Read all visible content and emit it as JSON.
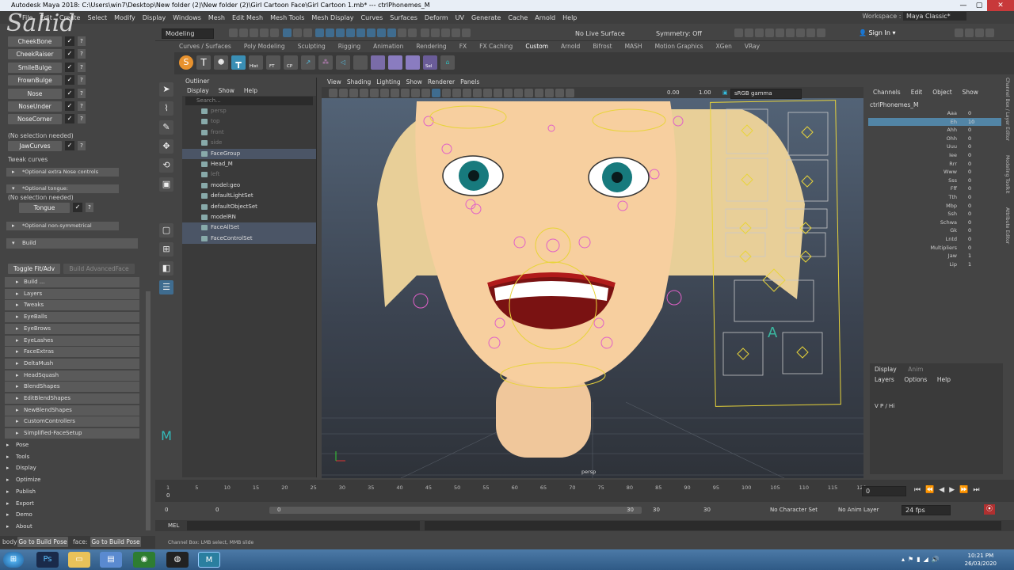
{
  "window": {
    "title": "Autodesk Maya 2018: C:\\Users\\win7\\Desktop\\New folder (2)\\New folder (2)\\Girl Cartoon Face\\Girl Cartoon 1.mb*   ---   ctrlPhonemes_M"
  },
  "menubar": [
    "File",
    "Edit",
    "Create",
    "Select",
    "Modify",
    "Display",
    "Windows",
    "Mesh",
    "Edit Mesh",
    "Mesh Tools",
    "Mesh Display",
    "Curves",
    "Surfaces",
    "Deform",
    "UV",
    "Generate",
    "Cache",
    "Arnold",
    "Help"
  ],
  "workspace": {
    "label": "Workspace :",
    "value": "Maya Classic*"
  },
  "statusline": {
    "mode": "Modeling",
    "live_surface": "No Live Surface",
    "symmetry": "Symmetry: Off",
    "signin": "Sign In"
  },
  "shelf_tabs": [
    "Curves / Surfaces",
    "Poly Modeling",
    "Sculpting",
    "Rigging",
    "Animation",
    "Rendering",
    "FX",
    "FX Caching",
    "Custom",
    "Arnold",
    "Bifrost",
    "MASH",
    "Motion Graphics",
    "XGen",
    "VRay"
  ],
  "shelf_labels": [
    "Hist",
    "FT",
    "CP",
    "Sel"
  ],
  "watermark": "Sahid",
  "rig_panel": {
    "controls": [
      "CheekBone",
      "CheekRaiser",
      "SmileBulge",
      "FrownBulge",
      "Nose",
      "NoseUnder",
      "NoseCorner"
    ],
    "no_sel_1": "(No selection needed)",
    "jaw_curves": "JawCurves",
    "tweak_curves": "Tweak curves",
    "opt_nose": "*Optional extra Nose controls",
    "opt_tongue": "*Optional tongue:",
    "no_sel_2": "(No selection needed)",
    "tongue": "Tongue",
    "opt_nonsym": "*Optional non-symmetrical",
    "build": "Build",
    "toggle_fit": "Toggle Fit/Adv",
    "build_adv": "Build AdvancedFace",
    "sub_items": [
      "Build ...",
      "Layers",
      "Tweaks",
      "EyeBalls",
      "EyeBrows",
      "EyeLashes",
      "FaceExtras",
      "DeltaMush",
      "HeadSquash",
      "BlendShapes",
      "EditBlendShapes",
      "NewBlendShapes",
      "CustomControllers",
      "Simplified-FaceSetup"
    ],
    "top_items": [
      "Pose",
      "Tools",
      "Display",
      "Optimize",
      "Publish",
      "Export",
      "Demo",
      "About"
    ],
    "check": "✓",
    "help": "?"
  },
  "bottom_left": {
    "body_label": "body",
    "body_btn": "Go to Build Pose",
    "face_label": "face:",
    "face_btn": "Go to Build Pose"
  },
  "outliner": {
    "title": "Outliner",
    "menu": [
      "Display",
      "Show",
      "Help"
    ],
    "search": "Search...",
    "items": [
      {
        "name": "persp",
        "dim": true,
        "hl": false
      },
      {
        "name": "top",
        "dim": true,
        "hl": false
      },
      {
        "name": "front",
        "dim": true,
        "hl": false
      },
      {
        "name": "side",
        "dim": true,
        "hl": false
      },
      {
        "name": "FaceGroup",
        "dim": false,
        "hl": true
      },
      {
        "name": "Head_M",
        "dim": false,
        "hl": false
      },
      {
        "name": "left",
        "dim": true,
        "hl": false
      },
      {
        "name": "model:geo",
        "dim": false,
        "hl": false
      },
      {
        "name": "defaultLightSet",
        "dim": false,
        "hl": false
      },
      {
        "name": "defaultObjectSet",
        "dim": false,
        "hl": false
      },
      {
        "name": "modelRN",
        "dim": false,
        "hl": false
      },
      {
        "name": "FaceAllSet",
        "dim": false,
        "hl": true
      },
      {
        "name": "FaceControlSet",
        "dim": false,
        "hl": true
      }
    ]
  },
  "viewport": {
    "menu": [
      "View",
      "Shading",
      "Lighting",
      "Show",
      "Renderer",
      "Panels"
    ],
    "near": "0.00",
    "far": "1.00",
    "colorspace": "sRGB gamma",
    "camera": "persp",
    "phoneme_letter": "A"
  },
  "channel_box": {
    "menu": [
      "Channels",
      "Edit",
      "Object",
      "Show"
    ],
    "object": "ctrlPhonemes_M",
    "attrs": [
      {
        "n": "Aaa",
        "v": "0",
        "sel": false
      },
      {
        "n": "Eh",
        "v": "10",
        "sel": true
      },
      {
        "n": "Ahh",
        "v": "0",
        "sel": false
      },
      {
        "n": "Ohh",
        "v": "0",
        "sel": false
      },
      {
        "n": "Uuu",
        "v": "0",
        "sel": false
      },
      {
        "n": "Iee",
        "v": "0",
        "sel": false
      },
      {
        "n": "Rrr",
        "v": "0",
        "sel": false
      },
      {
        "n": "Www",
        "v": "0",
        "sel": false
      },
      {
        "n": "Sss",
        "v": "0",
        "sel": false
      },
      {
        "n": "Fff",
        "v": "0",
        "sel": false
      },
      {
        "n": "Tth",
        "v": "0",
        "sel": false
      },
      {
        "n": "Mbp",
        "v": "0",
        "sel": false
      },
      {
        "n": "Ssh",
        "v": "0",
        "sel": false
      },
      {
        "n": "Schwa",
        "v": "0",
        "sel": false
      },
      {
        "n": "Gk",
        "v": "0",
        "sel": false
      },
      {
        "n": "Lntd",
        "v": "0",
        "sel": false
      },
      {
        "n": "Multipliers",
        "v": "0",
        "sel": false
      },
      {
        "n": "Jaw",
        "v": "1",
        "sel": false
      },
      {
        "n": "Lip",
        "v": "1",
        "sel": false
      }
    ]
  },
  "layer_panel": {
    "tabs": [
      "Display",
      "Anim"
    ],
    "menu": [
      "Layers",
      "Options",
      "Help"
    ],
    "row": "V   P         /   Hi"
  },
  "side_tabs": [
    "Channel Box / Layer Editor",
    "Modeling Toolkit",
    "Attribute Editor"
  ],
  "timeline": {
    "ticks": [
      "1",
      "5",
      "10",
      "15",
      "20",
      "25",
      "30",
      "35",
      "40",
      "45",
      "50",
      "55",
      "60",
      "65",
      "70",
      "75",
      "80",
      "85",
      "90",
      "95",
      "100",
      "105",
      "110",
      "115",
      "120"
    ],
    "current": "0",
    "end_field": "0"
  },
  "range": {
    "start": "0",
    "start2": "0",
    "range_start": "0",
    "range_end": "30",
    "end": "30",
    "end2": "30",
    "char_set": "No Character Set",
    "anim_layer": "No Anim Layer",
    "fps": "24 fps"
  },
  "cmd": {
    "lang": "MEL"
  },
  "helpline": "Channel Box: LMB select, MMB slide",
  "taskbar": {
    "time": "10:21 PM",
    "date": "26/03/2020",
    "apps": [
      "Ps",
      "▭",
      "▤",
      "◉",
      "◍",
      "M"
    ]
  }
}
